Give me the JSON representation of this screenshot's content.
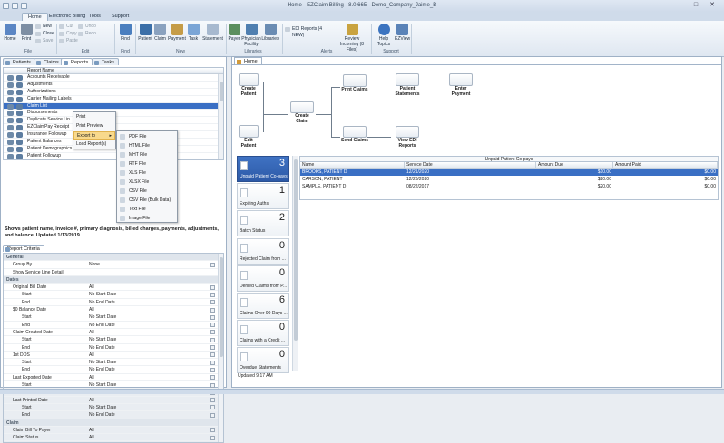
{
  "window": {
    "title": "Home - EZClaim Billing - 8.0.665 - Demo_Company_Jaime_B"
  },
  "ribbon_tabs": [
    "Home",
    "Electronic Billing",
    "Tools",
    "Support"
  ],
  "ribbon": {
    "file": {
      "buttons": [
        "Home",
        "Print"
      ],
      "small": [
        "New",
        "Close",
        "Save"
      ],
      "group": "File"
    },
    "edit": {
      "small": [
        "Cut",
        "Copy",
        "Paste",
        "Undo",
        "Redo"
      ],
      "group": "Edit"
    },
    "find": {
      "buttons": [
        "Find"
      ],
      "group": "Find"
    },
    "new": {
      "buttons": [
        "Patient",
        "Claim",
        "Payment",
        "Task",
        "Statement"
      ],
      "group": "New"
    },
    "libraries": {
      "buttons": [
        "Payer",
        "Physician Facility",
        "Libraries"
      ],
      "group": "Libraries"
    },
    "alerts": {
      "edi": "EDI Reports (4 NEW)",
      "button": "Review Incoming (8 Files)",
      "group": "Alerts"
    },
    "support": {
      "buttons": [
        "Help Topics",
        "EZView"
      ],
      "group": "Support"
    }
  },
  "left_tabs": [
    "Patients",
    "Claims",
    "Reports",
    "Tasks"
  ],
  "reports": {
    "header": "Report Name",
    "items": [
      "Accounts Receivable",
      "Adjustments",
      "Authorizations",
      "Carrier Mailing Labels",
      "Claim List",
      "Disbursements",
      "Duplicate Service Lin",
      "EZClaimPay Receipt",
      "Insurance Followup",
      "Patient Balances",
      "Patient Demographics",
      "Patient Followup"
    ],
    "selected_index": 4,
    "description": "Shows patient name, invoice #, primary diagnosis, billed charges, payments, adjustments, and balance. Updated 1/13/2019"
  },
  "context_menu": {
    "items": [
      "Print",
      "Print Preview",
      "Export to",
      "Load Report(s)"
    ],
    "highlight_index": 2
  },
  "export_menu": {
    "items": [
      "PDF File",
      "HTML File",
      "MHT File",
      "RTF File",
      "XLS File",
      "XLSX File",
      "CSV File",
      "CSV File (Bulk Data)",
      "Text File",
      "Image File"
    ]
  },
  "criteria": {
    "tab": "Report Criteria",
    "rows": [
      {
        "k": "General",
        "v": "",
        "t": "sec"
      },
      {
        "k": "Group By",
        "v": "None",
        "t": "sub"
      },
      {
        "k": "Show Service Line Detail",
        "v": "",
        "t": "sub"
      },
      {
        "k": "Dates",
        "v": "",
        "t": "sec"
      },
      {
        "k": "Original Bill Date",
        "v": "All",
        "t": "sub"
      },
      {
        "k": "Start",
        "v": "No Start Date",
        "t": "sub2"
      },
      {
        "k": "End",
        "v": "No End Date",
        "t": "sub2"
      },
      {
        "k": "$0 Balance Date",
        "v": "All",
        "t": "sub"
      },
      {
        "k": "Start",
        "v": "No Start Date",
        "t": "sub2"
      },
      {
        "k": "End",
        "v": "No End Date",
        "t": "sub2"
      },
      {
        "k": "Claim Created Date",
        "v": "All",
        "t": "sub"
      },
      {
        "k": "Start",
        "v": "No Start Date",
        "t": "sub2"
      },
      {
        "k": "End",
        "v": "No End Date",
        "t": "sub2"
      },
      {
        "k": "1st DOS",
        "v": "All",
        "t": "sub"
      },
      {
        "k": "Start",
        "v": "No Start Date",
        "t": "sub2"
      },
      {
        "k": "End",
        "v": "No End Date",
        "t": "sub2"
      },
      {
        "k": "Last Exported Date",
        "v": "All",
        "t": "sub"
      },
      {
        "k": "Start",
        "v": "No Start Date",
        "t": "sub2"
      },
      {
        "k": "End",
        "v": "No End Date",
        "t": "sub2"
      },
      {
        "k": "Last Printed Date",
        "v": "All",
        "t": "sub"
      },
      {
        "k": "Start",
        "v": "No Start Date",
        "t": "sub2"
      },
      {
        "k": "End",
        "v": "No End Date",
        "t": "sub2"
      },
      {
        "k": "Claim",
        "v": "",
        "t": "sec"
      },
      {
        "k": "Claim Bill To Payer",
        "v": "All",
        "t": "sub"
      },
      {
        "k": "Claim Status",
        "v": "All",
        "t": "sub"
      }
    ]
  },
  "home_tab": "Home",
  "workflow": {
    "create_patient": "Create Patient",
    "edit_patient": "Edit Patient",
    "create_claim": "Create Claim",
    "print_claims": "Print Claims",
    "send_claims": "Send Claims",
    "patient_statements": "Patient Statements",
    "view_edi": "View EDI Reports",
    "enter_payment": "Enter Payment"
  },
  "tiles": [
    {
      "num": "3",
      "label": "Unpaid Patient Co-pays",
      "selected": true
    },
    {
      "num": "1",
      "label": "Expiring Auths"
    },
    {
      "num": "2",
      "label": "Batch Status"
    },
    {
      "num": "0",
      "label": "Rejected Claim from ..."
    },
    {
      "num": "0",
      "label": "Denied Claims from P..."
    },
    {
      "num": "6",
      "label": "Claims Over 90 Days ..."
    },
    {
      "num": "0",
      "label": "Claims with a Credit ..."
    },
    {
      "num": "0",
      "label": "Overdue Statements"
    }
  ],
  "updated": "Updated 9:17 AM",
  "copays": {
    "title": "Unpaid Patient Co-pays",
    "headers": [
      "Name",
      "Service Date",
      "Amount Due",
      "Amount Paid"
    ],
    "rows": [
      [
        "BROOKS, PATIENT D",
        "12/21/2020",
        "$10.00",
        "$0.00"
      ],
      [
        "CARSON, PATIENT",
        "12/26/2020",
        "$20.00",
        "$0.00"
      ],
      [
        "SAMPLE, PATIENT D",
        "08/22/2017",
        "$20.00",
        "$0.00"
      ]
    ]
  },
  "colors": {
    "accent": "#3a6fc4",
    "menu_highlight": "#f8d98c"
  }
}
